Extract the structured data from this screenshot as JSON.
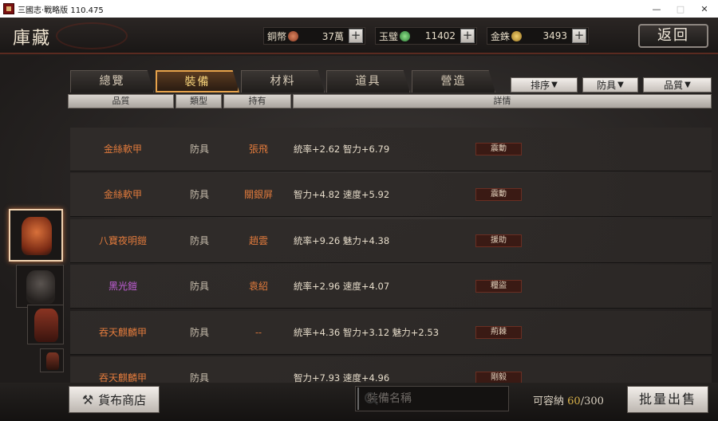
{
  "window": {
    "title": "三國志·戰略版 110.475",
    "minimize": "—",
    "maximize": "□",
    "close": "✕"
  },
  "header": {
    "title": "庫藏",
    "back_label": "返回",
    "currencies": [
      {
        "label": "銅幣",
        "amount": "37萬",
        "color": "#b0553a",
        "plus": "+"
      },
      {
        "label": "玉璧",
        "amount": "11402",
        "color": "#3a9a4a",
        "plus": "+"
      },
      {
        "label": "金銖",
        "amount": "3493",
        "color": "#c9a030",
        "plus": "+"
      }
    ]
  },
  "tabs": [
    {
      "label": "總覽"
    },
    {
      "label": "裝備",
      "active": true
    },
    {
      "label": "材料"
    },
    {
      "label": "道具"
    },
    {
      "label": "營造"
    }
  ],
  "filters": [
    {
      "label": "排序",
      "arrow": "▼"
    },
    {
      "label": "防具",
      "arrow": "▼"
    },
    {
      "label": "品質",
      "arrow": "▼"
    }
  ],
  "columns": [
    "品質",
    "類型",
    "持有",
    "詳情"
  ],
  "items": [
    {
      "name": "金絲軟甲",
      "name_color": "#e07a3c",
      "type": "防具",
      "owner": "張飛",
      "stats": "統率+2.62  智力+6.79",
      "badge": "震動"
    },
    {
      "name": "金絲軟甲",
      "name_color": "#e07a3c",
      "type": "防具",
      "owner": "關銀屏",
      "stats": "智力+4.82  速度+5.92",
      "badge": "震動"
    },
    {
      "name": "八寶夜明鎧",
      "name_color": "#e07a3c",
      "type": "防具",
      "owner": "趙雲",
      "stats": "統率+9.26  魅力+4.38",
      "badge": "援助"
    },
    {
      "name": "黑光鎧",
      "name_color": "#c25fd8",
      "type": "防具",
      "owner": "袁紹",
      "stats": "統率+2.96  速度+4.07",
      "badge": "糧盜"
    },
    {
      "name": "吞天麒麟甲",
      "name_color": "#e07a3c",
      "type": "防具",
      "owner": "--",
      "stats": "統率+4.36  智力+3.12  魅力+2.53",
      "badge": "荊棘"
    },
    {
      "name": "吞天麒麟甲",
      "name_color": "#e07a3c",
      "type": "防具",
      "owner": "",
      "stats": "智力+7.93  速度+4.96",
      "badge": "剛毅"
    }
  ],
  "bottom": {
    "shop_label": "貨布商店",
    "search_placeholder": "裝備名稱",
    "capacity_label": "可容納",
    "capacity_used": "60",
    "capacity_total": "/300",
    "sell_label": "批量出售"
  }
}
